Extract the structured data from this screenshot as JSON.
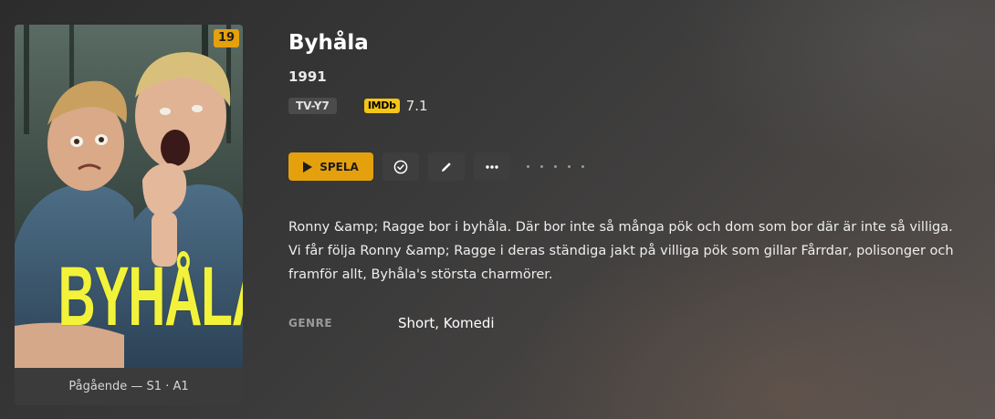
{
  "poster": {
    "badge_count": "19",
    "art_title": "BYHÅLA",
    "caption": "Pågående — S1 · A1",
    "badge_color": "#e5a00d",
    "art_title_color": "#f2f23a"
  },
  "show": {
    "title": "Byhåla",
    "year": "1991",
    "content_rating": "TV-Y7",
    "imdb_label": "IMDb",
    "imdb_score": "7.1",
    "summary": "Ronny &amp; Ragge bor i byhåla. Där bor inte så många pök och dom som bor där är inte så villiga. Vi får följa Ronny &amp; Ragge i deras ständiga jakt på villiga pök som gillar Fårrdar, polisonger och framför allt, Byhåla's största charmörer.",
    "genre_label": "GENRE",
    "genre_value": "Short, Komedi"
  },
  "actions": {
    "play_label": "SPELA",
    "accent_color": "#e5a00d",
    "icons": [
      "play-icon",
      "check-circle-icon",
      "pencil-icon",
      "more-icon"
    ]
  }
}
